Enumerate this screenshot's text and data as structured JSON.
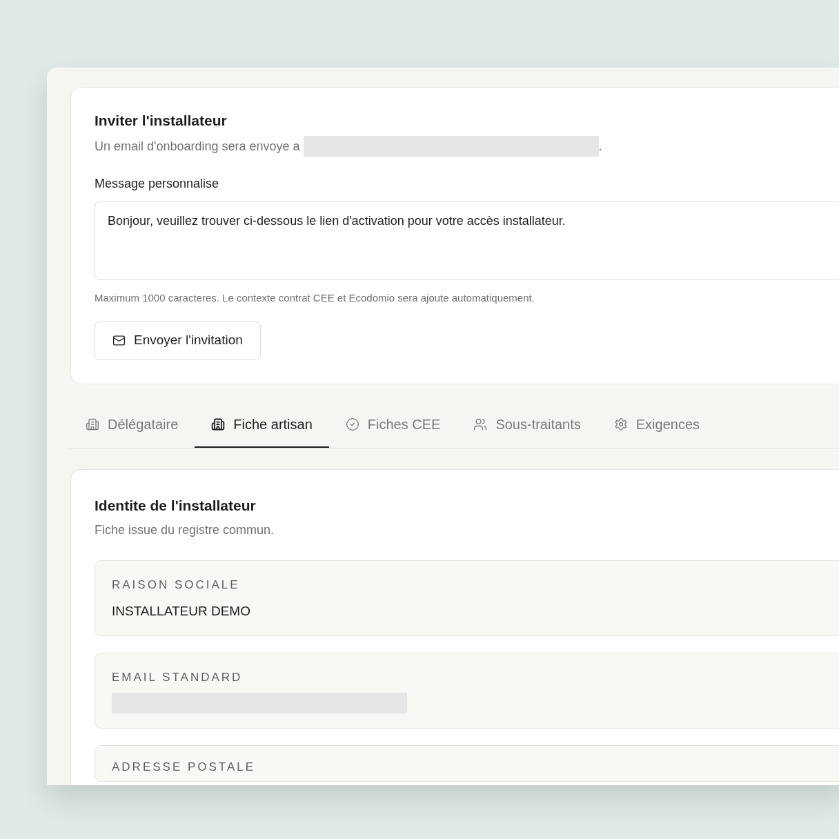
{
  "invite": {
    "title": "Inviter l'installateur",
    "subtitle": "Un email d'onboarding sera envoye a",
    "subtitle_end": ".",
    "message_label": "Message personnalise",
    "message_value": "Bonjour, veuillez trouver ci-dessous le lien d'activation pour votre accès installateur.",
    "hint": "Maximum 1000 caracteres. Le contexte contrat CEE et Ecodomio sera ajoute automatiquement.",
    "button": "Envoyer l'invitation"
  },
  "tabs": [
    {
      "label": "Délégataire",
      "selected": false
    },
    {
      "label": "Fiche artisan",
      "selected": true
    },
    {
      "label": "Fiches CEE",
      "selected": false
    },
    {
      "label": "Sous-traitants",
      "selected": false
    },
    {
      "label": "Exigences",
      "selected": false
    }
  ],
  "identity": {
    "title": "Identite de l'installateur",
    "subtitle": "Fiche issue du registre commun.",
    "fields": [
      {
        "label": "RAISON SOCIALE",
        "kind": "text",
        "value": "INSTALLATEUR DEMO"
      },
      {
        "label": "EMAIL STANDARD",
        "kind": "redacted"
      },
      {
        "label": "ADRESSE POSTALE",
        "kind": "empty"
      }
    ]
  }
}
